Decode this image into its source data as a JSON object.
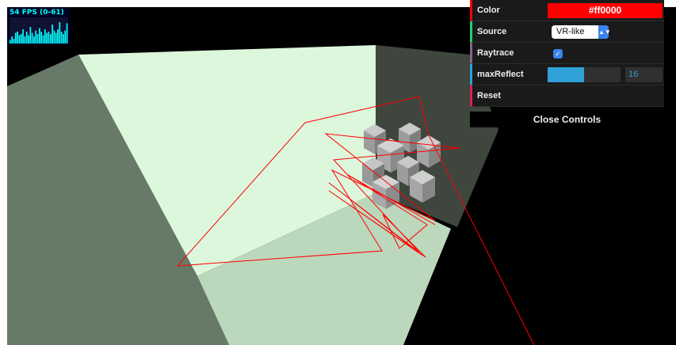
{
  "stats": {
    "fps_text": "54 FPS (0-61)",
    "bars": [
      0.15,
      0.3,
      0.2,
      0.45,
      0.5,
      0.35,
      0.4,
      0.6,
      0.3,
      0.5,
      0.35,
      0.7,
      0.45,
      0.3,
      0.55,
      0.4,
      0.65,
      0.5,
      0.35,
      0.6,
      0.45,
      0.5,
      0.4,
      0.8,
      0.55,
      0.45,
      0.6,
      0.9,
      0.5,
      0.4,
      0.55,
      0.85
    ]
  },
  "gui": {
    "color_label": "Color",
    "color_value": "#ff0000",
    "source_label": "Source",
    "source_value": "VR-like",
    "raytrace_label": "Raytrace",
    "raytrace_checked": true,
    "max_reflect_label": "maxReflect",
    "max_reflect_value": "16",
    "max_reflect_fraction": 0.5,
    "reset_label": "Reset",
    "close_label": "Close Controls"
  },
  "colors": {
    "ray": "#ff0000",
    "floor": "#bcd8bc",
    "back_wall": "#dcf7dc",
    "left_wall": "#677a67",
    "right_wall": "#3e463e",
    "cube": "#b9b9b9"
  }
}
